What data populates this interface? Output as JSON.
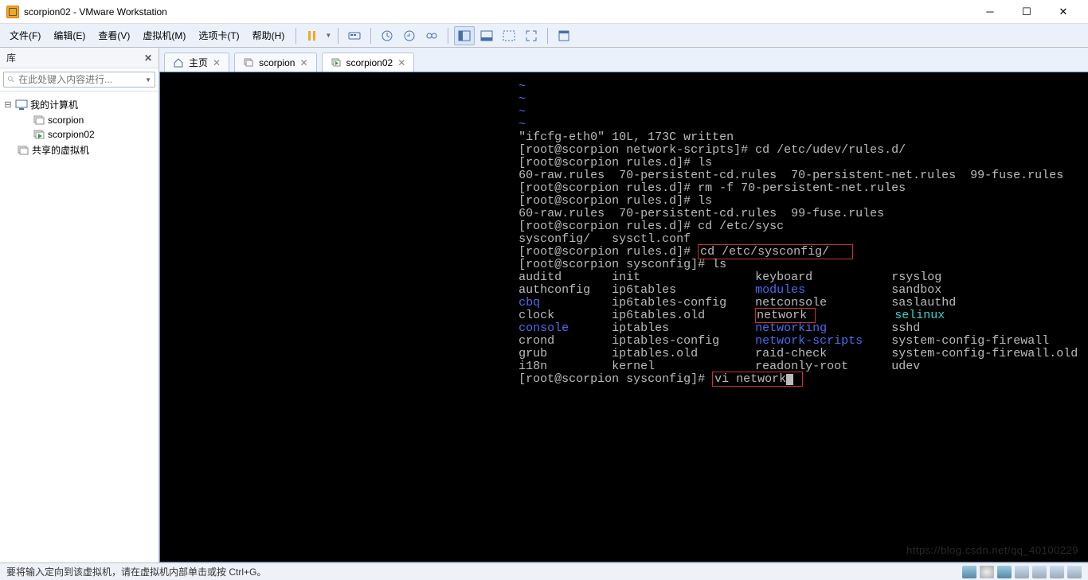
{
  "window": {
    "title": "scorpion02 - VMware Workstation",
    "minimize": "─",
    "maximize": "☐",
    "close": "✕"
  },
  "menu": {
    "file": "文件(F)",
    "edit": "编辑(E)",
    "view": "查看(V)",
    "vm": "虚拟机(M)",
    "tabs": "选项卡(T)",
    "help": "帮助(H)"
  },
  "sidebar": {
    "title": "库",
    "close": "✕",
    "search_placeholder": "在此处键入内容进行...",
    "tree": {
      "my_computer": "我的计算机",
      "vm1": "scorpion",
      "vm2": "scorpion02",
      "shared": "共享的虚拟机"
    }
  },
  "tabs": {
    "home": "主页",
    "vm1": "scorpion",
    "vm2": "scorpion02"
  },
  "terminal": {
    "blue_tilde1": "~",
    "blue_tilde2": "~",
    "blue_tilde3": "~",
    "blue_tilde4": "~",
    "l1": "\"ifcfg-eth0\" 10L, 173C written",
    "l2p": "[root@scorpion network-scripts]# ",
    "l2c": "cd /etc/udev/rules.d/",
    "l3p": "[root@scorpion rules.d]# ",
    "l3c": "ls",
    "l4": "60-raw.rules  70-persistent-cd.rules  70-persistent-net.rules  99-fuse.rules",
    "l5p": "[root@scorpion rules.d]# ",
    "l5c": "rm -f 70-persistent-net.rules",
    "l6p": "[root@scorpion rules.d]# ",
    "l6c": "ls",
    "l7": "60-raw.rules  70-persistent-cd.rules  99-fuse.rules",
    "l8p": "[root@scorpion rules.d]# ",
    "l8c": "cd /etc/sysc",
    "l9": "sysconfig/   sysctl.conf",
    "l10p": "[root@scorpion rules.d]# ",
    "l10c": "cd /etc/sysconfig/",
    "l11p": "[root@scorpion sysconfig]# ",
    "l11c": "ls",
    "ls_col1": [
      "auditd",
      "authconfig",
      "cbq",
      "clock",
      "console",
      "crond",
      "grub",
      "i18n"
    ],
    "ls_col2": [
      "init",
      "ip6tables",
      "ip6tables-config",
      "ip6tables.old",
      "iptables",
      "iptables-config",
      "iptables.old",
      "kernel"
    ],
    "ls_col3": [
      "keyboard",
      "modules",
      "netconsole",
      "network",
      "networking",
      "network-scripts",
      "raid-check",
      "readonly-root"
    ],
    "ls_col4": [
      "rsyslog",
      "sandbox",
      "saslauthd",
      "selinux",
      "sshd",
      "system-config-firewall",
      "system-config-firewall.old",
      "udev"
    ],
    "l12p": "[root@scorpion sysconfig]# ",
    "l12c": "vi network"
  },
  "status": {
    "text": "要将输入定向到该虚拟机，请在虚拟机内部单击或按 Ctrl+G。"
  },
  "watermark": "https://blog.csdn.net/qq_40100229"
}
